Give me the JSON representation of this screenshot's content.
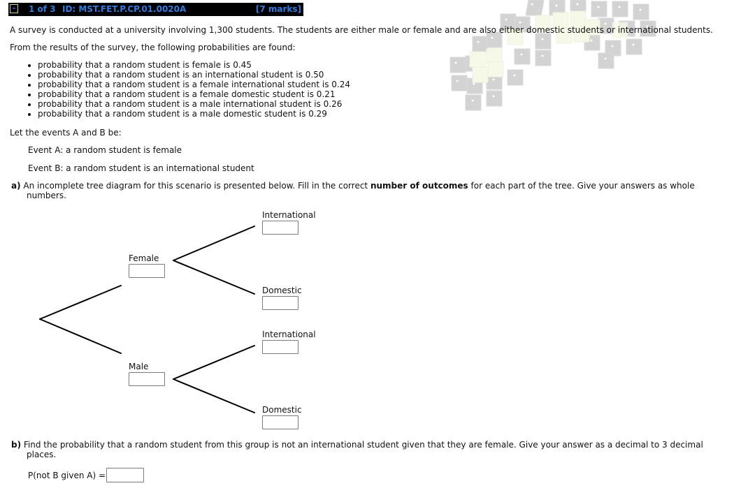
{
  "header": {
    "collapse_symbol": "-",
    "question_position": "1 of 3",
    "question_id": "ID: MST.FET.P.CP.01.0020A",
    "marks": "[7  marks]",
    "colors": {
      "background": "#000000",
      "text": "#2f7de0",
      "collapse_border": "#d6d99a"
    }
  },
  "decoration": {
    "icon": "dice-cluster-image"
  },
  "intro": {
    "sentence": "A survey is conducted at a university involving 1,300 students. The students are either male or female and are also either domestic students or international students.",
    "results_lead": "From the results of the survey, the following probabilities are found:",
    "probabilities": [
      "probability that a random student is female is 0.45",
      "probability that a random student is an international student is 0.50",
      "probability that a random student is a female international student is 0.24",
      "probability that a random student is a female domestic student is 0.21",
      "probability that a random student is a male international student is 0.26",
      "probability that a random student is a male domestic student is 0.29"
    ],
    "events_lead": "Let the events A and B be:",
    "event_a": "Event A: a random student is female",
    "event_b": "Event B: a random student is an international student"
  },
  "part_a": {
    "label": "a)",
    "text_before": "An incomplete tree diagram for this scenario is presented below. Fill in the correct",
    "text_bold": "number of outcomes",
    "text_after": "for each part of the tree. Give your answers as whole numbers.",
    "tree": {
      "female": {
        "label": "Female",
        "value": ""
      },
      "male": {
        "label": "Male",
        "value": ""
      },
      "female_international": {
        "label": "International",
        "value": ""
      },
      "female_domestic": {
        "label": "Domestic",
        "value": ""
      },
      "male_international": {
        "label": "International",
        "value": ""
      },
      "male_domestic": {
        "label": "Domestic",
        "value": ""
      }
    }
  },
  "part_b": {
    "label": "b)",
    "text": "Find the probability that a random student from this group is not an international student given that they are female. Give your answer as a decimal to 3 decimal places.",
    "answer_label": "P(not B given A) =",
    "answer_value": ""
  }
}
